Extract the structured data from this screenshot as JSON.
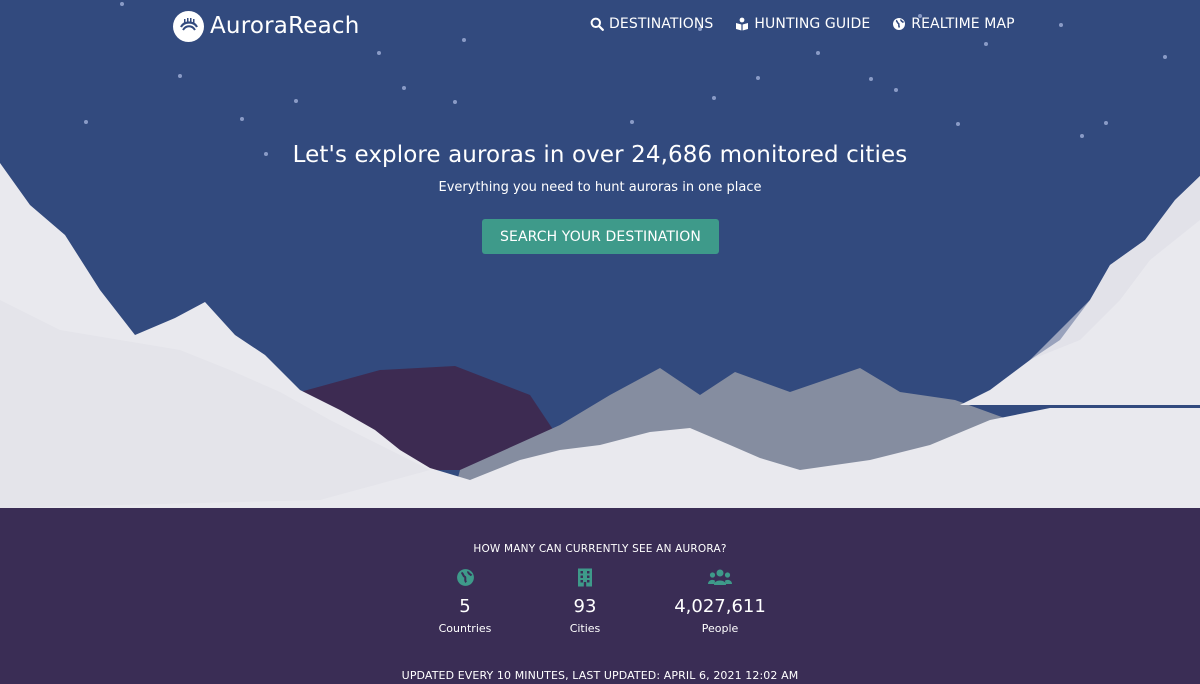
{
  "brand": {
    "name": "AuroraReach",
    "logo_icon": "aurora-logo-icon"
  },
  "nav": [
    {
      "label": "DESTINATIONS",
      "icon": "search-icon"
    },
    {
      "label": "HUNTING GUIDE",
      "icon": "guide-icon"
    },
    {
      "label": "REALTIME MAP",
      "icon": "globe-icon"
    }
  ],
  "hero": {
    "headline": "Let's explore auroras in over 24,686 monitored cities",
    "subline": "Everything you need to hunt auroras in one place",
    "cta_label": "SEARCH YOUR DESTINATION"
  },
  "stats": {
    "title": "HOW MANY CAN CURRENTLY SEE AN AURORA?",
    "items": [
      {
        "value": "5",
        "label": "Countries",
        "icon": "globe-icon"
      },
      {
        "value": "93",
        "label": "Cities",
        "icon": "building-icon"
      },
      {
        "value": "4,027,611",
        "label": "People",
        "icon": "users-icon"
      }
    ],
    "updated": "UPDATED EVERY 10 MINUTES, LAST UPDATED: APRIL 6, 2021 12:02 AM"
  },
  "colors": {
    "sky": "#324a7e",
    "footer": "#3a2d55",
    "accent": "#3e9a8a",
    "snow": "#e8e8ee",
    "mountain_grey": "#858da0",
    "mountain_purple": "#3d2b52"
  }
}
